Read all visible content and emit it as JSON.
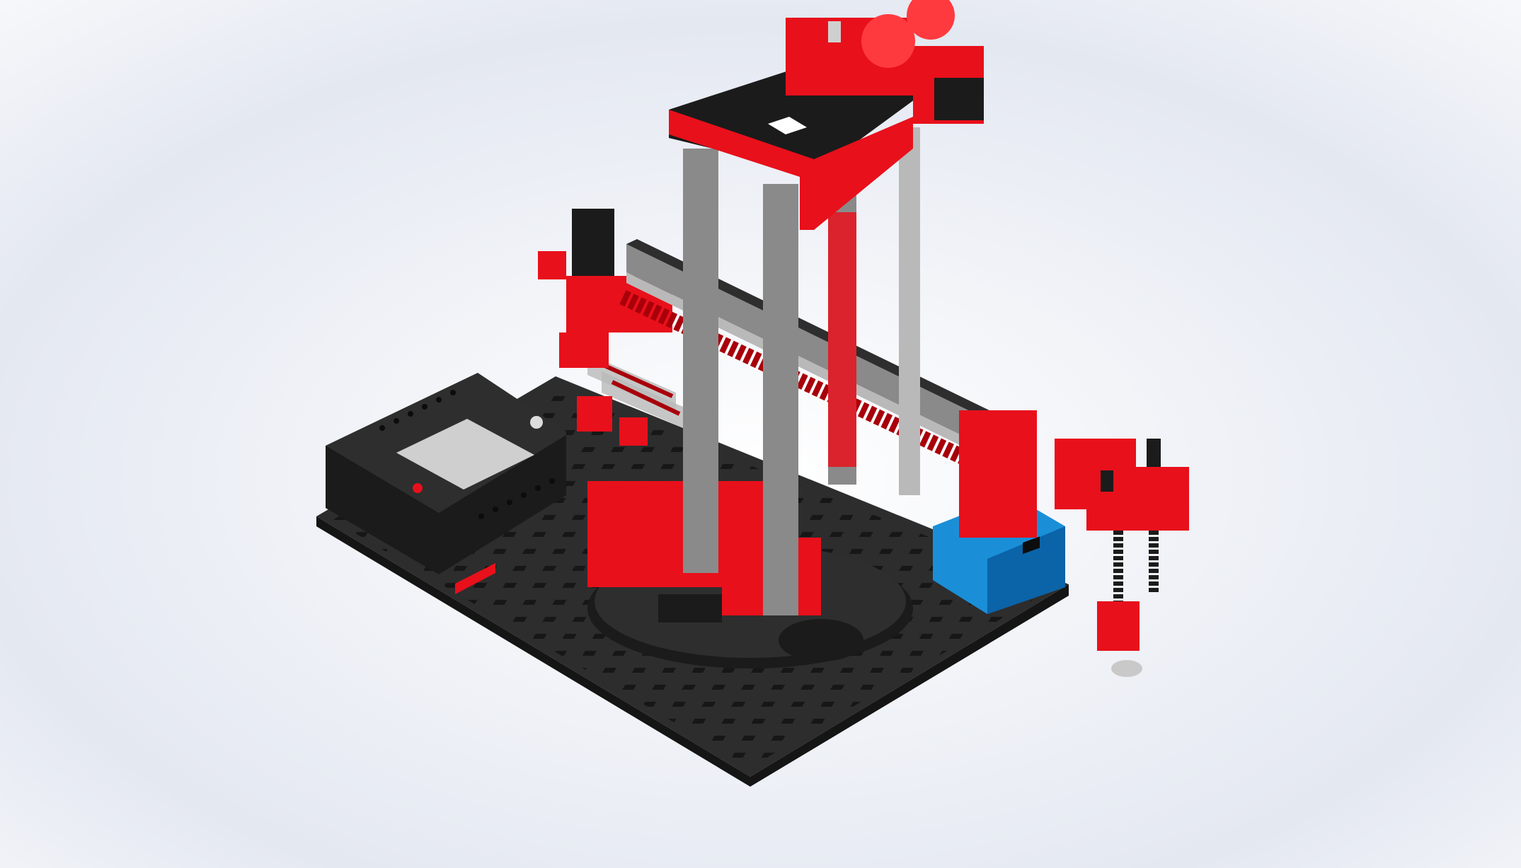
{
  "viewport": {
    "background_top": "#ffffff",
    "background_mid": "#e4e8f1",
    "background_edge": "#f7f8fb"
  },
  "model": {
    "colors": {
      "brick_red": "#e8101b",
      "brick_red_dark": "#a8000a",
      "brick_red_light": "#ff3a3f",
      "black": "#1b1b1b",
      "black_mid": "#2e2e2e",
      "baseplate": "#2d2d2d",
      "baseplate_side": "#151515",
      "aluminium": "#8a8a8a",
      "aluminium_light": "#b9b9b9",
      "blue": "#1a8fd8",
      "blue_dark": "#0b63a8",
      "screen": "#cfcfcf",
      "rod": "#d8d8d8"
    },
    "parts": [
      "baseplate",
      "controller",
      "turntable",
      "vertical-column",
      "top-gearbox",
      "horizontal-arm",
      "spindle",
      "pneumatic-cylinders",
      "compressor",
      "suction-gripper",
      "blue-box"
    ]
  }
}
